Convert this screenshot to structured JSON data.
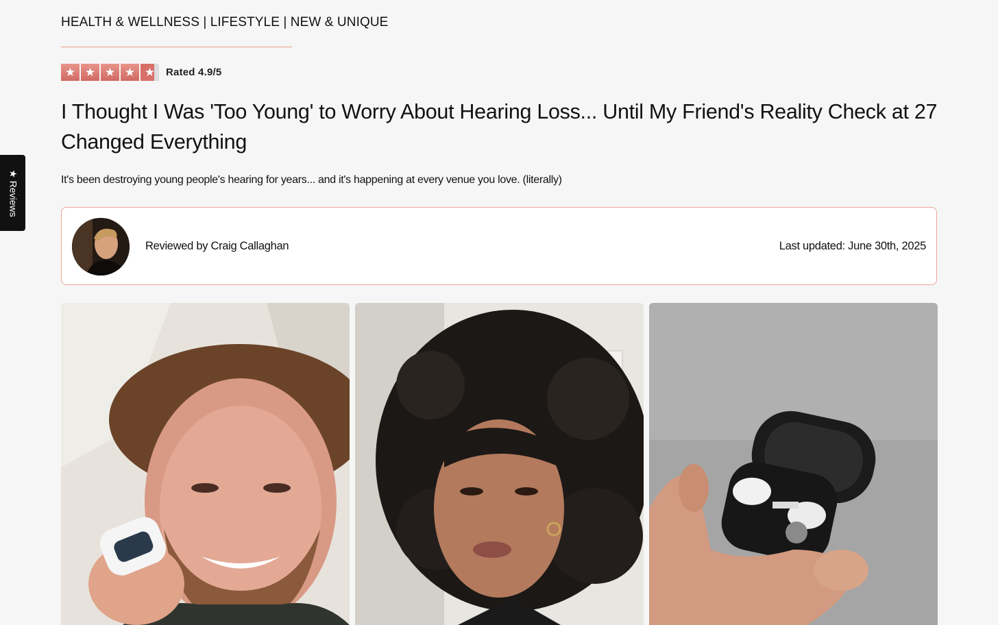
{
  "header": {
    "categories": "HEALTH & WELLNESS | LIFESTYLE | NEW & UNIQUE"
  },
  "rating": {
    "stars_filled": 4.9,
    "stars_total": 5,
    "text": "Rated 4.9/5",
    "star_color": "#e08078"
  },
  "article": {
    "headline": "I Thought I Was 'Too Young' to Worry About Hearing Loss... Until My Friend's Reality Check at 27 Changed Everything",
    "subheadline": "It's been destroying young people's hearing for years... and it's happening at every venue you love. (literally)"
  },
  "review_card": {
    "reviewed_by": "Reviewed by Craig Callaghan",
    "last_updated": "Last updated: June 30th, 2025",
    "border_color": "#eba79a"
  },
  "photos": [
    {
      "subject": "man-with-earbuds-case"
    },
    {
      "subject": "woman-with-curly-hair"
    },
    {
      "subject": "hand-holding-earbuds-case"
    }
  ],
  "side_tab": {
    "icon": "star-icon",
    "label": "Reviews"
  }
}
